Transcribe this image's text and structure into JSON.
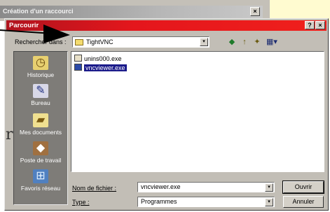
{
  "outer_window": {
    "title": "Création d'un raccourci",
    "close": "×"
  },
  "dialog": {
    "title": "Parcourir",
    "help": "?",
    "close": "×",
    "look_in": {
      "label": "Rechercher dans :",
      "value": "TightVNC",
      "dropdown": "▾"
    },
    "toolbar": {
      "back": "◆",
      "up": "↑",
      "new_folder": "✦",
      "views": "▦▾"
    },
    "places": [
      {
        "label": "Historique",
        "icon": "history-icon"
      },
      {
        "label": "Bureau",
        "icon": "desktop-icon"
      },
      {
        "label": "Mes documents",
        "icon": "documents-icon"
      },
      {
        "label": "Poste de travail",
        "icon": "computer-icon"
      },
      {
        "label": "Favoris réseau",
        "icon": "network-icon"
      }
    ],
    "files": [
      {
        "name": "unins000.exe",
        "selected": false
      },
      {
        "name": "vncviewer.exe",
        "selected": true
      }
    ],
    "filename": {
      "label": "Nom de fichier :",
      "value": "vncviewer.exe",
      "dropdown": "▾"
    },
    "filetype": {
      "label": "Type :",
      "value": "Programmes",
      "dropdown": "▾"
    },
    "buttons": {
      "open": "Ouvrir",
      "cancel": "Annuler"
    }
  },
  "annotation": {
    "bracket": "r"
  },
  "colors": {
    "titlebar": "#e4161c",
    "places_bg": "#7e7c78",
    "selection": "#1a1a8a"
  }
}
